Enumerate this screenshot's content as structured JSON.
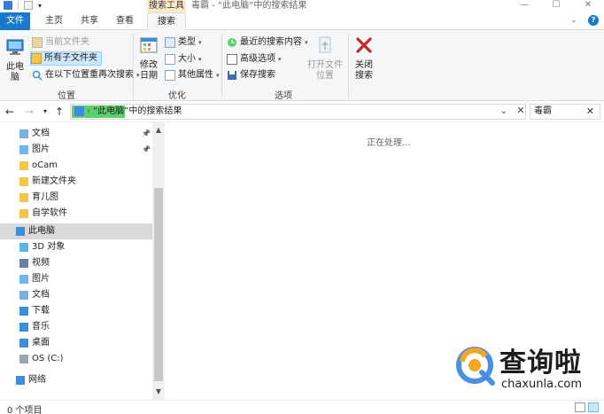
{
  "titlebar": {
    "context_tab": "搜索工具",
    "window_title": "毒霸 - “此电脑”中的搜索结果",
    "minimize": "—",
    "maximize": "☐",
    "close": "✕"
  },
  "tabs": {
    "file": "文件",
    "home": "主页",
    "share": "共享",
    "view": "查看",
    "search": "搜索"
  },
  "ribbon": {
    "location": {
      "this_pc": "此电脑",
      "current_folder": "当前文件夹",
      "all_subfolders": "所有子文件夹",
      "search_again": "在以下位置重再次搜索",
      "label": "位置"
    },
    "refine": {
      "date_modified": "修改日期",
      "kind": "类型",
      "size": "大小",
      "other_properties": "其他属性",
      "label": "优化"
    },
    "options": {
      "recent_searches": "最近的搜索内容",
      "advanced_options": "高级选项",
      "save_search": "保存搜索",
      "open_file_location": "打开文件位置",
      "label": "选项"
    },
    "close": {
      "close_search": "关闭搜索"
    }
  },
  "addressbar": {
    "path": "“此电脑”中的搜索结果"
  },
  "search": {
    "value": "毒霸"
  },
  "navpane": {
    "quick_access": [
      {
        "label": "文档",
        "pinned": true
      },
      {
        "label": "图片",
        "pinned": true
      },
      {
        "label": "oCam",
        "pinned": false
      },
      {
        "label": "新建文件夹",
        "pinned": false
      },
      {
        "label": "育儿图",
        "pinned": false
      },
      {
        "label": "自学软件",
        "pinned": false
      }
    ],
    "this_pc": "此电脑",
    "this_pc_items": [
      "3D 对象",
      "视频",
      "图片",
      "文档",
      "下载",
      "音乐",
      "桌面",
      "OS (C:)"
    ],
    "network": "网络"
  },
  "content": {
    "status": "正在处理..."
  },
  "statusbar": {
    "count": "0 个项目"
  },
  "watermark": {
    "brand": "查询啦",
    "url": "chaxunla.com"
  },
  "colors": {
    "accent": "#1979ca",
    "address_highlight": "#5cd06a",
    "close_search_red": "#c1272d",
    "selected_bg": "#cce8ff"
  }
}
